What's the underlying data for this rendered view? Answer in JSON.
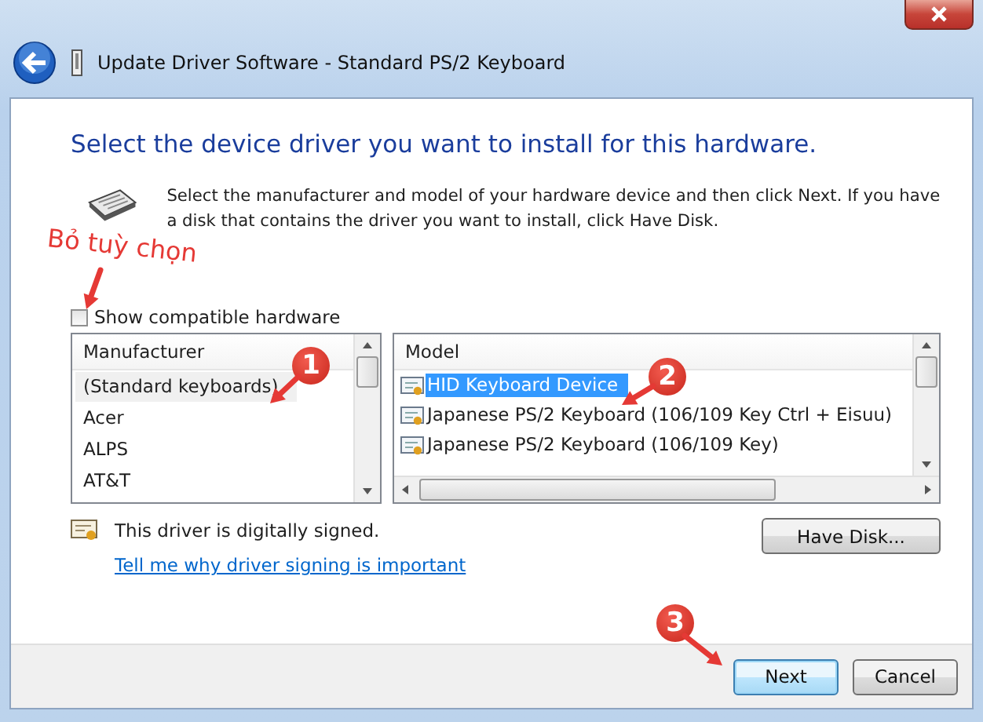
{
  "window": {
    "title": "Update Driver Software - Standard PS/2 Keyboard"
  },
  "heading": "Select the device driver you want to install for this hardware.",
  "description": "Select the manufacturer and model of your hardware device and then click Next. If you have a disk that contains the driver you want to install, click Have Disk.",
  "show_compatible": {
    "label": "Show compatible hardware",
    "checked": false
  },
  "manufacturer_list": {
    "header": "Manufacturer",
    "items": [
      {
        "label": "(Standard keyboards)",
        "selected": true
      },
      {
        "label": "Acer",
        "selected": false
      },
      {
        "label": "ALPS",
        "selected": false
      },
      {
        "label": "AT&T",
        "selected": false
      }
    ]
  },
  "model_list": {
    "header": "Model",
    "items": [
      {
        "label": "HID Keyboard Device",
        "selected": true
      },
      {
        "label": "Japanese PS/2 Keyboard (106/109 Key Ctrl + Eisuu)",
        "selected": false
      },
      {
        "label": "Japanese PS/2 Keyboard (106/109 Key)",
        "selected": false
      }
    ]
  },
  "signature": "This driver is digitally signed.",
  "link": "Tell me why driver signing is important",
  "have_disk_button": "Have Disk...",
  "buttons": [
    {
      "label": "Next",
      "kind": "default"
    },
    {
      "label": "Cancel",
      "kind": "normal"
    }
  ],
  "annotations": [
    {
      "kind": "note",
      "text": "Bỏ tuỳ chọn"
    },
    {
      "kind": "badge",
      "text": "1"
    },
    {
      "kind": "badge",
      "text": "2"
    },
    {
      "kind": "badge",
      "text": "3"
    }
  ]
}
